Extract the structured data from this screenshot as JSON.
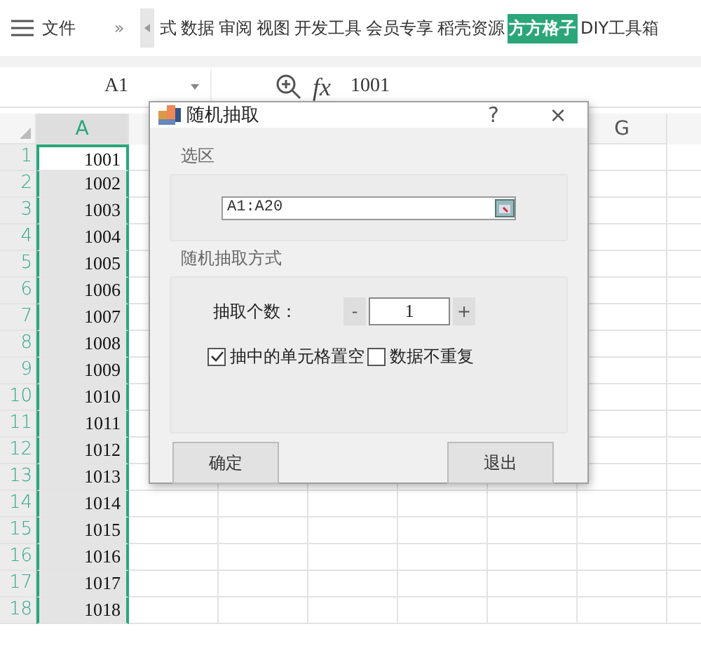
{
  "ribbon": {
    "menu_label": "文件",
    "overflow": "»",
    "tabs": [
      {
        "label": "式",
        "selected": false
      },
      {
        "label": "数据",
        "selected": false
      },
      {
        "label": "审阅",
        "selected": false
      },
      {
        "label": "视图",
        "selected": false
      },
      {
        "label": "开发工具",
        "selected": false
      },
      {
        "label": "会员专享",
        "selected": false
      },
      {
        "label": "稻壳资源",
        "selected": false
      },
      {
        "label": "方方格子",
        "selected": true
      },
      {
        "label": "DIY工具箱",
        "selected": false
      }
    ]
  },
  "formula_bar": {
    "cell_ref": "A1",
    "function_label": "fx",
    "formula": "1001"
  },
  "sheet": {
    "columns": [
      {
        "label": "A",
        "selected": true
      },
      {
        "label": "G",
        "selected": false
      }
    ],
    "rows": [
      {
        "number": "1",
        "value": "1001",
        "selected": true,
        "active": true
      },
      {
        "number": "2",
        "value": "1002",
        "selected": true,
        "active": false
      },
      {
        "number": "3",
        "value": "1003",
        "selected": true,
        "active": false
      },
      {
        "number": "4",
        "value": "1004",
        "selected": true,
        "active": false
      },
      {
        "number": "5",
        "value": "1005",
        "selected": true,
        "active": false
      },
      {
        "number": "6",
        "value": "1006",
        "selected": true,
        "active": false
      },
      {
        "number": "7",
        "value": "1007",
        "selected": true,
        "active": false
      },
      {
        "number": "8",
        "value": "1008",
        "selected": true,
        "active": false
      },
      {
        "number": "9",
        "value": "1009",
        "selected": true,
        "active": false
      },
      {
        "number": "10",
        "value": "1010",
        "selected": true,
        "active": false
      },
      {
        "number": "11",
        "value": "1011",
        "selected": true,
        "active": false
      },
      {
        "number": "12",
        "value": "1012",
        "selected": true,
        "active": false
      },
      {
        "number": "13",
        "value": "1013",
        "selected": true,
        "active": false
      },
      {
        "number": "14",
        "value": "1014",
        "selected": true,
        "active": false
      },
      {
        "number": "15",
        "value": "1015",
        "selected": true,
        "active": false
      },
      {
        "number": "16",
        "value": "1016",
        "selected": true,
        "active": false
      },
      {
        "number": "17",
        "value": "1017",
        "selected": true,
        "active": false
      },
      {
        "number": "18",
        "value": "1018",
        "selected": true,
        "active": false
      }
    ]
  },
  "dialog": {
    "title": "随机抽取",
    "help": "?",
    "close": "×",
    "range_group": {
      "label": "选区",
      "value": "A1:A20"
    },
    "mode_group": {
      "label": "随机抽取方式",
      "count_label": "抽取个数：",
      "decrement": "-",
      "count": "1",
      "increment": "+",
      "options": [
        {
          "label": "抽中的单元格置空",
          "checked": true
        },
        {
          "label": "数据不重复",
          "checked": false
        }
      ]
    },
    "buttons": [
      "确定",
      "退出"
    ]
  }
}
